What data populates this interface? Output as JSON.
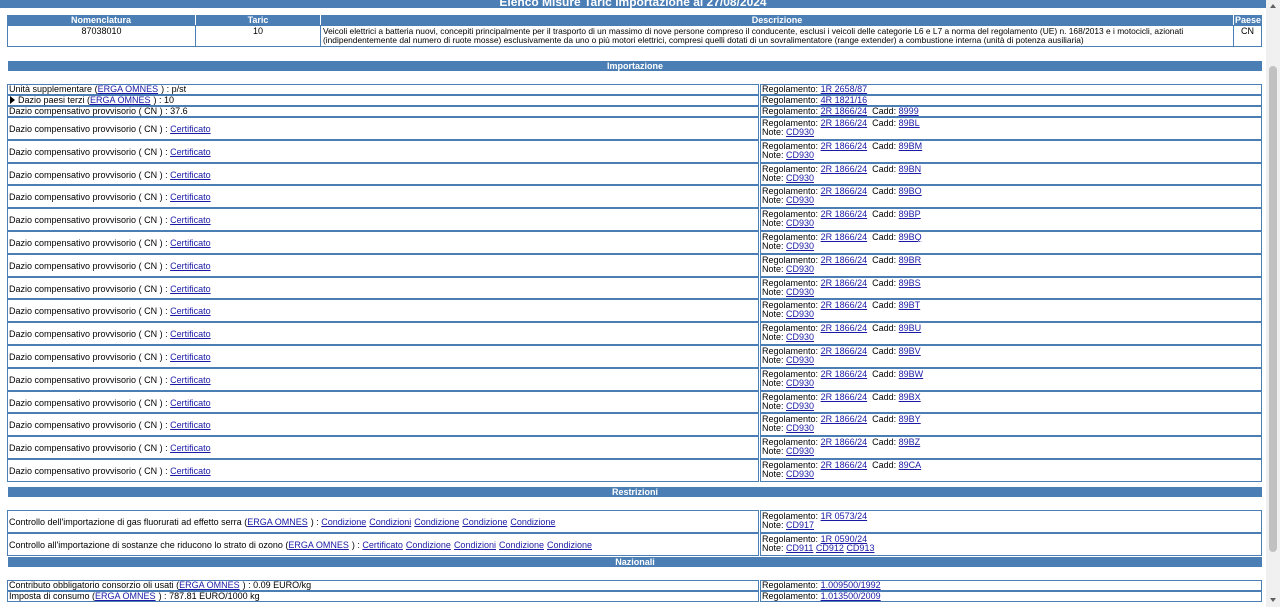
{
  "banner": "Elenco Misure Taric Importazione al 27/08/2024",
  "headers": {
    "nomenclatura": "Nomenclatura",
    "taric": "Taric",
    "descrizione": "Descrizione",
    "paese": "Paese"
  },
  "product": {
    "nomenclatura": "87038010",
    "taric": "10",
    "descrizione": "Veicoli elettrici a batteria nuovi, concepiti principalmente per il trasporto di un massimo di nove persone compreso il conducente, esclusi i veicoli delle categorie L6 e L7 a norma del regolamento (UE) n. 168/2013 e i motocicli, azionati (indipendentemente dal numero di ruote mosse) esclusivamente da uno o più motori elettrici, compresi quelli dotati di un sovralimentatore (range extender) a combustione interna (unità di potenza ausiliaria)",
    "paese": "CN"
  },
  "sections": {
    "importazione": "Importazione",
    "restrizioni": "Restrizioni",
    "nazionali": "Nazionali"
  },
  "importazione": {
    "unita": {
      "label": "Unità supplementare",
      "link": "ERGA OMNES",
      "value": "p/st",
      "reg_label": "Regolamento:",
      "reg": "1R 2658/87"
    },
    "dazio_terzi": {
      "label": "Dazio paesi terzi",
      "link": "ERGA OMNES",
      "value": "10",
      "reg_label": "Regolamento:",
      "reg": "4R 1821/16"
    },
    "dazio_376": {
      "label": "Dazio compensativo provvisorio",
      "country": "( CN ) :",
      "value": "37.6",
      "reg_label": "Regolamento:",
      "reg": "2R 1866/24",
      "cadd_label": "Cadd:",
      "cadd": "8999"
    },
    "rows": [
      {
        "label": "Dazio compensativo provvisorio",
        "country": "( CN ) :",
        "cert": "Certificato",
        "reg_label": "Regolamento:",
        "reg": "2R 1866/24",
        "cadd_label": "Cadd:",
        "cadd": "89BL",
        "note_label": "Note:",
        "note": "CD930"
      },
      {
        "label": "Dazio compensativo provvisorio",
        "country": "( CN ) :",
        "cert": "Certificato",
        "reg_label": "Regolamento:",
        "reg": "2R 1866/24",
        "cadd_label": "Cadd:",
        "cadd": "89BM",
        "note_label": "Note:",
        "note": "CD930"
      },
      {
        "label": "Dazio compensativo provvisorio",
        "country": "( CN ) :",
        "cert": "Certificato",
        "reg_label": "Regolamento:",
        "reg": "2R 1866/24",
        "cadd_label": "Cadd:",
        "cadd": "89BN",
        "note_label": "Note:",
        "note": "CD930"
      },
      {
        "label": "Dazio compensativo provvisorio",
        "country": "( CN ) :",
        "cert": "Certificato",
        "reg_label": "Regolamento:",
        "reg": "2R 1866/24",
        "cadd_label": "Cadd:",
        "cadd": "89BO",
        "note_label": "Note:",
        "note": "CD930"
      },
      {
        "label": "Dazio compensativo provvisorio",
        "country": "( CN ) :",
        "cert": "Certificato",
        "reg_label": "Regolamento:",
        "reg": "2R 1866/24",
        "cadd_label": "Cadd:",
        "cadd": "89BP",
        "note_label": "Note:",
        "note": "CD930"
      },
      {
        "label": "Dazio compensativo provvisorio",
        "country": "( CN ) :",
        "cert": "Certificato",
        "reg_label": "Regolamento:",
        "reg": "2R 1866/24",
        "cadd_label": "Cadd:",
        "cadd": "89BQ",
        "note_label": "Note:",
        "note": "CD930"
      },
      {
        "label": "Dazio compensativo provvisorio",
        "country": "( CN ) :",
        "cert": "Certificato",
        "reg_label": "Regolamento:",
        "reg": "2R 1866/24",
        "cadd_label": "Cadd:",
        "cadd": "89BR",
        "note_label": "Note:",
        "note": "CD930"
      },
      {
        "label": "Dazio compensativo provvisorio",
        "country": "( CN ) :",
        "cert": "Certificato",
        "reg_label": "Regolamento:",
        "reg": "2R 1866/24",
        "cadd_label": "Cadd:",
        "cadd": "89BS",
        "note_label": "Note:",
        "note": "CD930"
      },
      {
        "label": "Dazio compensativo provvisorio",
        "country": "( CN ) :",
        "cert": "Certificato",
        "reg_label": "Regolamento:",
        "reg": "2R 1866/24",
        "cadd_label": "Cadd:",
        "cadd": "89BT",
        "note_label": "Note:",
        "note": "CD930"
      },
      {
        "label": "Dazio compensativo provvisorio",
        "country": "( CN ) :",
        "cert": "Certificato",
        "reg_label": "Regolamento:",
        "reg": "2R 1866/24",
        "cadd_label": "Cadd:",
        "cadd": "89BU",
        "note_label": "Note:",
        "note": "CD930"
      },
      {
        "label": "Dazio compensativo provvisorio",
        "country": "( CN ) :",
        "cert": "Certificato",
        "reg_label": "Regolamento:",
        "reg": "2R 1866/24",
        "cadd_label": "Cadd:",
        "cadd": "89BV",
        "note_label": "Note:",
        "note": "CD930"
      },
      {
        "label": "Dazio compensativo provvisorio",
        "country": "( CN ) :",
        "cert": "Certificato",
        "reg_label": "Regolamento:",
        "reg": "2R 1866/24",
        "cadd_label": "Cadd:",
        "cadd": "89BW",
        "note_label": "Note:",
        "note": "CD930"
      },
      {
        "label": "Dazio compensativo provvisorio",
        "country": "( CN ) :",
        "cert": "Certificato",
        "reg_label": "Regolamento:",
        "reg": "2R 1866/24",
        "cadd_label": "Cadd:",
        "cadd": "89BX",
        "note_label": "Note:",
        "note": "CD930"
      },
      {
        "label": "Dazio compensativo provvisorio",
        "country": "( CN ) :",
        "cert": "Certificato",
        "reg_label": "Regolamento:",
        "reg": "2R 1866/24",
        "cadd_label": "Cadd:",
        "cadd": "89BY",
        "note_label": "Note:",
        "note": "CD930"
      },
      {
        "label": "Dazio compensativo provvisorio",
        "country": "( CN ) :",
        "cert": "Certificato",
        "reg_label": "Regolamento:",
        "reg": "2R 1866/24",
        "cadd_label": "Cadd:",
        "cadd": "89BZ",
        "note_label": "Note:",
        "note": "CD930"
      },
      {
        "label": "Dazio compensativo provvisorio",
        "country": "( CN ) :",
        "cert": "Certificato",
        "reg_label": "Regolamento:",
        "reg": "2R 1866/24",
        "cadd_label": "Cadd:",
        "cadd": "89CA",
        "note_label": "Note:",
        "note": "CD930"
      }
    ]
  },
  "restrizioni": [
    {
      "label": "Controllo dell'importazione di gas fluorurati ad effetto serra",
      "link": "ERGA OMNES",
      "links": [
        "Condizione",
        "Condizioni",
        "Condizione",
        "Condizione",
        "Condizione"
      ],
      "reg_label": "Regolamento:",
      "reg": "1R 0573/24",
      "note_label": "Note:",
      "notes": [
        "CD917"
      ]
    },
    {
      "label": "Controllo all'importazione di sostanze che riducono lo strato di ozono",
      "link": "ERGA OMNES",
      "links": [
        "Certificato",
        "Condizione",
        "Condizioni",
        "Condizione",
        "Condizione"
      ],
      "reg_label": "Regolamento:",
      "reg": "1R 0590/24",
      "note_label": "Note:",
      "notes": [
        "CD911",
        "CD912",
        "CD913"
      ]
    }
  ],
  "nazionali": [
    {
      "label": "Contributo obbligatorio consorzio oli usati",
      "link": "ERGA OMNES",
      "value": "0.09 EURO/kg",
      "reg_label": "Regolamento:",
      "reg": "1.009500/1992"
    },
    {
      "label": "Imposta di consumo",
      "link": "ERGA OMNES",
      "value": "787.81 EURO/1000 kg",
      "reg_label": "Regolamento:",
      "reg": "1.013500/2009"
    }
  ]
}
